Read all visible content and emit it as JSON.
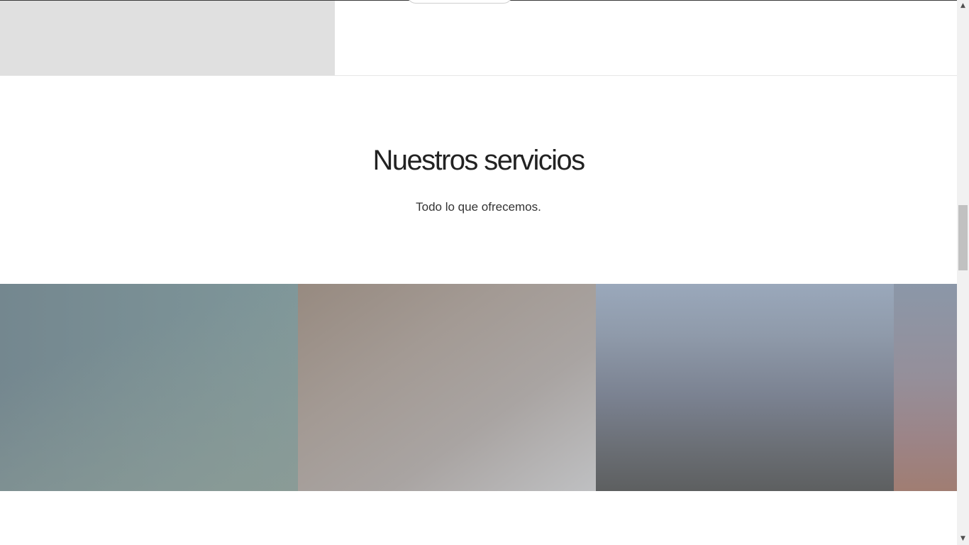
{
  "services_section": {
    "heading": "Nuestros servicios",
    "subtitle": "Todo lo que ofrecemos."
  },
  "service_cards": [
    {
      "image": "blurred-teal-grey-photo"
    },
    {
      "image": "blurred-taupe-grey-photo"
    },
    {
      "image": "blurred-blue-grey-sky-photo"
    },
    {
      "image": "blurred-mauve-photo-partial"
    }
  ],
  "scrollbar": {
    "up_arrow_icon": "triangle-up-icon",
    "down_arrow_icon": "triangle-down-icon",
    "up_glyph": "▲",
    "down_glyph": "▼"
  },
  "colors": {
    "background": "#ffffff",
    "placeholder_grey": "#e0e0e0",
    "heading_text": "#222222",
    "body_text": "#333333"
  }
}
